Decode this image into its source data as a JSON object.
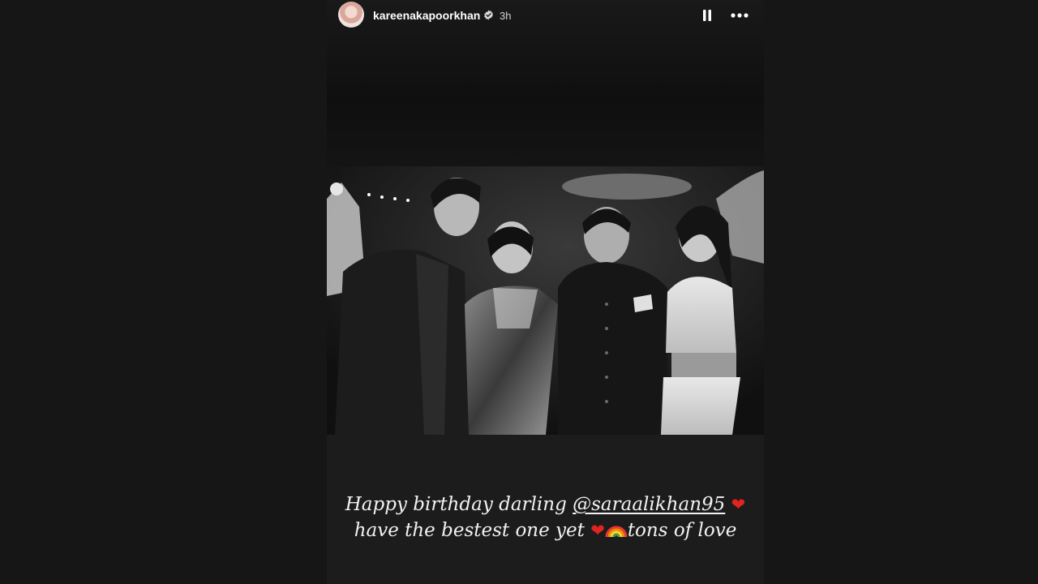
{
  "story": {
    "username": "kareenakapoorkhan",
    "time_ago": "3h",
    "verified": true,
    "caption": {
      "line1_text": "Happy birthday darling ",
      "mention": "@saraalikhan95",
      "line2_text": "have the bestest one yet ",
      "line2_end": "tons of love",
      "heart_glyph": "❤",
      "emoji_names": [
        "red-heart",
        "red-heart",
        "rainbow"
      ]
    }
  },
  "icons": {
    "pause": "pause-icon",
    "more": "more-options-icon",
    "verified": "verified-badge-icon"
  },
  "colors": {
    "background": "#161616",
    "story_background": "#1b1b1b",
    "heart": "#e0241f",
    "text": "#f2f2f2"
  }
}
